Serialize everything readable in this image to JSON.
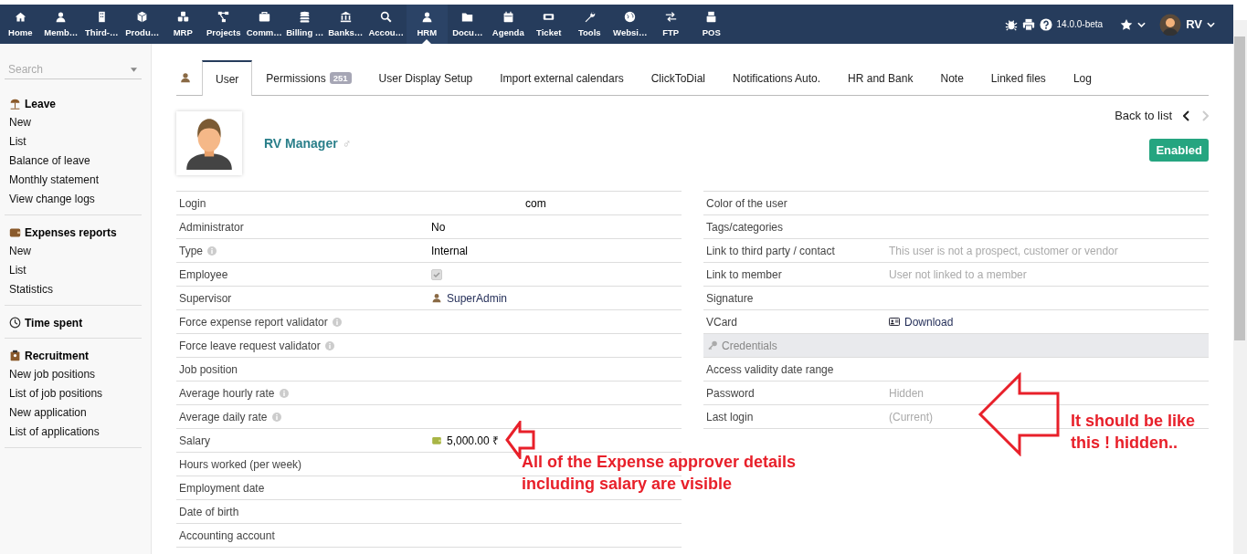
{
  "top_menu": [
    {
      "label": "Home",
      "selected": false
    },
    {
      "label": "Memb…",
      "selected": false
    },
    {
      "label": "Third-…",
      "selected": false
    },
    {
      "label": "Produ…",
      "selected": false
    },
    {
      "label": "MRP",
      "selected": false
    },
    {
      "label": "Projects",
      "selected": false
    },
    {
      "label": "Comm…",
      "selected": false
    },
    {
      "label": "Billing …",
      "selected": false
    },
    {
      "label": "Banks…",
      "selected": false
    },
    {
      "label": "Accou…",
      "selected": false
    },
    {
      "label": "HRM",
      "selected": true
    },
    {
      "label": "Docu…",
      "selected": false
    },
    {
      "label": "Agenda",
      "selected": false
    },
    {
      "label": "Ticket",
      "selected": false
    },
    {
      "label": "Tools",
      "selected": false
    },
    {
      "label": "Websi…",
      "selected": false
    },
    {
      "label": "FTP",
      "selected": false
    },
    {
      "label": "POS",
      "selected": false
    }
  ],
  "top_right": {
    "version": "14.0.0-beta",
    "user": "RV"
  },
  "sidebar": {
    "search": {
      "placeholder": "Search"
    },
    "sections": [
      {
        "title": "Leave",
        "items": [
          "New",
          "List",
          "Balance of leave",
          "Monthly statement",
          "View change logs"
        ]
      },
      {
        "title": "Expenses reports",
        "items": [
          "New",
          "List",
          "Statistics"
        ]
      },
      {
        "title": "Time spent"
      },
      {
        "title": "Recruitment",
        "items": [
          "New job positions",
          "List of job positions",
          "New application",
          "List of applications"
        ]
      }
    ]
  },
  "tabs": [
    {
      "label": "User",
      "selected": true
    },
    {
      "label": "Permissions",
      "badge": "251",
      "selected": false
    },
    {
      "label": "User Display Setup",
      "selected": false
    },
    {
      "label": "Import external calendars",
      "selected": false
    },
    {
      "label": "ClickToDial",
      "selected": false
    },
    {
      "label": "Notifications Auto.",
      "selected": false
    },
    {
      "label": "HR and Bank",
      "selected": false
    },
    {
      "label": "Note",
      "selected": false
    },
    {
      "label": "Linked files",
      "selected": false
    },
    {
      "label": "Log",
      "selected": false
    }
  ],
  "header": {
    "name": "RV Manager",
    "gender_symbol": "♂",
    "back_link": "Back to list",
    "previous_enabled": true,
    "next_enabled": false,
    "status": "Enabled"
  },
  "left_fields": [
    {
      "label": "Login",
      "info": false,
      "kind": "text",
      "value": "com"
    },
    {
      "label": "Administrator",
      "info": false,
      "kind": "text",
      "value": "No"
    },
    {
      "label": "Type",
      "info": true,
      "kind": "text",
      "value": "Internal"
    },
    {
      "label": "Employee",
      "info": false,
      "kind": "checkbox",
      "checked": true
    },
    {
      "label": "Supervisor",
      "info": false,
      "kind": "user",
      "value": "SuperAdmin"
    },
    {
      "label": "Force expense report validator",
      "info": true,
      "kind": "text"
    },
    {
      "label": "Force leave request validator",
      "info": true,
      "kind": "text"
    },
    {
      "label": "Job position",
      "info": false,
      "kind": "text"
    },
    {
      "label": "Average hourly rate",
      "info": true,
      "kind": "text"
    },
    {
      "label": "Average daily rate",
      "info": true,
      "kind": "text"
    },
    {
      "label": "Salary",
      "info": false,
      "kind": "money",
      "value": "5,000.00 ₹"
    },
    {
      "label": "Hours worked (per week)",
      "info": false,
      "kind": "text"
    },
    {
      "label": "Employment date",
      "info": false,
      "kind": "text"
    },
    {
      "label": "Date of birth",
      "info": false,
      "kind": "text"
    },
    {
      "label": "Accounting account",
      "info": false,
      "kind": "text"
    }
  ],
  "right_fields": [
    {
      "label": "Color of the user",
      "kind": "text"
    },
    {
      "label": "Tags/categories",
      "kind": "text"
    },
    {
      "label": "Link to third party / contact",
      "kind": "muted",
      "value": "This user is not a prospect, customer or vendor"
    },
    {
      "label": "Link to member",
      "kind": "muted",
      "value": "User not linked to a member"
    },
    {
      "label": "Signature",
      "kind": "text"
    },
    {
      "label": "VCard",
      "kind": "download",
      "value": "Download"
    },
    {
      "label": "Credentials",
      "kind": "section"
    },
    {
      "label": "Access validity date range",
      "kind": "text"
    },
    {
      "label": "Password",
      "kind": "muted",
      "value": "Hidden"
    },
    {
      "label": "Last login",
      "kind": "muted",
      "value": "(Current)"
    }
  ],
  "annotations": [
    {
      "text": "All of the Expense approver details including salary are visible"
    },
    {
      "text": "It should be like this ! hidden.."
    }
  ]
}
